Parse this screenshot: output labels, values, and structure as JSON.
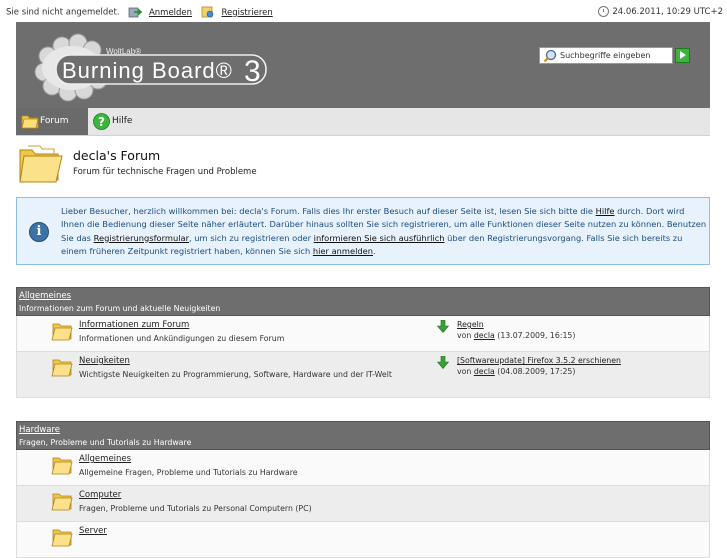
{
  "topbar": {
    "not_logged_in": "Sie sind nicht angemeldet.",
    "login": "Anmelden",
    "register": "Registrieren",
    "datetime": "24.06.2011, 10:29 UTC+2"
  },
  "header": {
    "logo_small": "WoltLab®",
    "logo_main": "Burning Board®",
    "logo_num": "3",
    "search_placeholder": "Suchbegriffe eingeben"
  },
  "nav": {
    "forum": "Forum",
    "help": "Hilfe"
  },
  "page": {
    "title": "decla's Forum",
    "subtitle": "Forum für technische Fragen und Probleme"
  },
  "info": {
    "t1": "Lieber Besucher, herzlich willkommen bei: decla's Forum. Falls dies Ihr erster Besuch auf dieser Seite ist, lesen Sie sich bitte die ",
    "l1": "Hilfe",
    "t2": " durch. Dort wird Ihnen die Bedienung dieser Seite näher erläutert. Darüber hinaus sollten Sie sich registrieren, um alle Funktionen dieser Seite nutzen zu können. Benutzen Sie das ",
    "l2": "Registrierungsformular",
    "t3": ", um sich zu registrieren oder ",
    "l3": "informieren Sie sich ausführlich",
    "t4": " über den Registrierungsvorgang. Falls Sie sich bereits zu einem früheren Zeitpunkt registriert haben, können Sie sich ",
    "l4": "hier anmelden",
    "t5": "."
  },
  "categories": [
    {
      "name": "Allgemeines",
      "desc": "Informationen zum Forum und aktuelle Neuigkeiten",
      "boards": [
        {
          "name": "Informationen zum Forum",
          "desc": "Informationen und Ankündigungen zu diesem Forum",
          "last_title": "Regeln",
          "last_by": "von ",
          "last_user": "decla",
          "last_date": " (13.07.2009, 16:15)"
        },
        {
          "name": "Neuigkeiten",
          "desc": "Wichtigste Neuigkeiten zu Programmierung, Software, Hardware und der IT-Welt",
          "last_title": "[Softwareupdate] Firefox 3.5.2 erschienen",
          "last_by": "von ",
          "last_user": "decla",
          "last_date": " (04.08.2009, 17:25)"
        }
      ]
    },
    {
      "name": "Hardware",
      "desc": "Fragen, Probleme und Tutorials zu Hardware",
      "boards": [
        {
          "name": "Allgemeines",
          "desc": "Allgemeine Fragen, Probleme und Tutorials zu Hardware"
        },
        {
          "name": "Computer",
          "desc": "Fragen, Probleme und Tutorials zu Personal Computern (PC)"
        },
        {
          "name": "Server",
          "desc": ""
        }
      ]
    }
  ]
}
